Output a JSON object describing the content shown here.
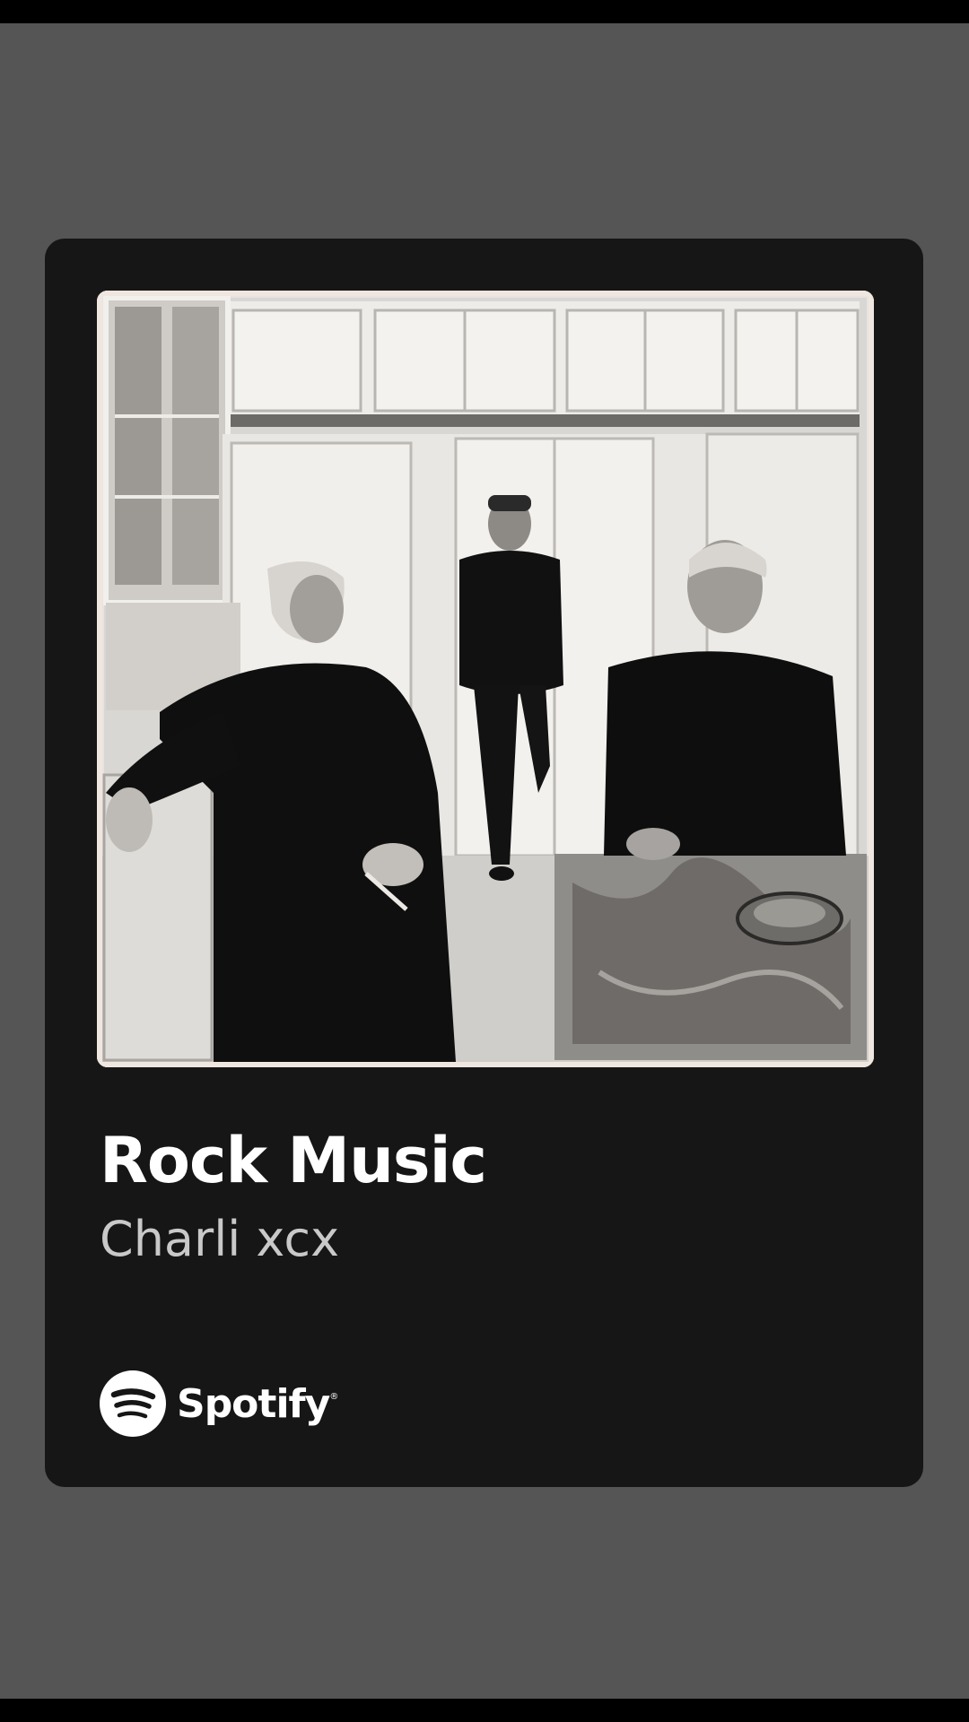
{
  "share_card": {
    "album_art": {
      "description_icon": "album-cover-photo"
    },
    "title": "Rock Music",
    "artist": "Charli xcx",
    "brand": {
      "name": "Spotify",
      "icon": "spotify-icon"
    }
  },
  "colors": {
    "screen_background": "#555555",
    "card_background": "#161616",
    "title_text": "#ffffff",
    "artist_text": "#c9c9c9"
  }
}
